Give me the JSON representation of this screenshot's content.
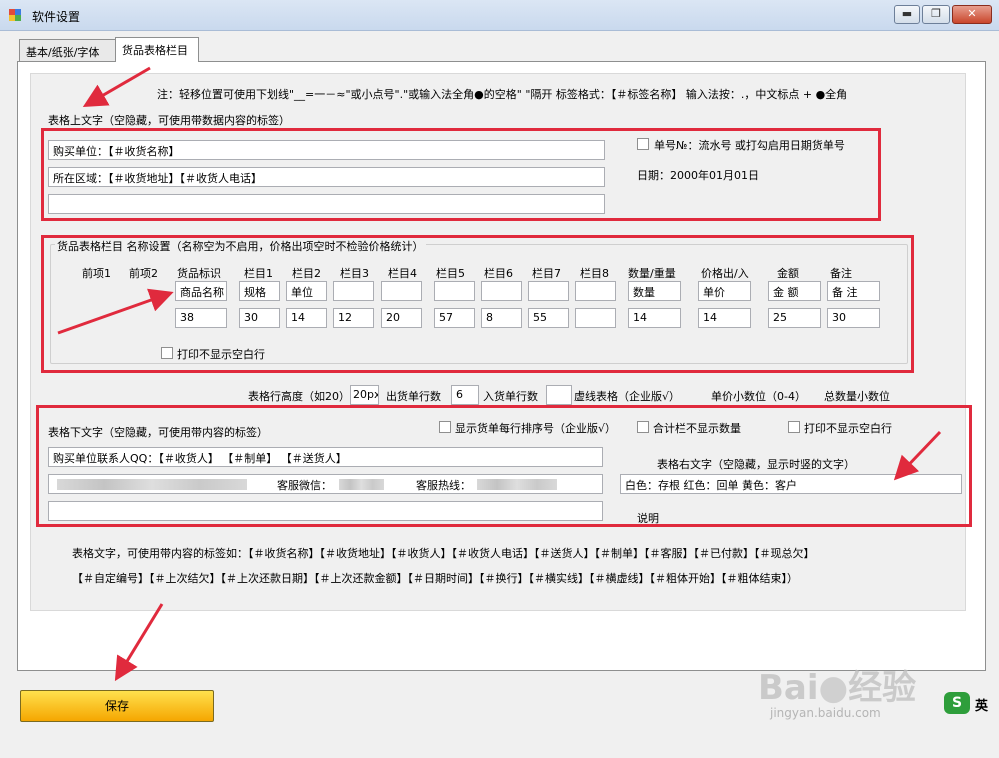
{
  "window": {
    "title": "软件设置",
    "minimize": "▬",
    "maximize": "❐",
    "close": "✕"
  },
  "tabs": [
    {
      "label": "基本/纸张/字体"
    },
    {
      "label": "货品表格栏目"
    }
  ],
  "note": "注：轻移位置可使用下划线\"__=一－≈\"或小点号\".\"或输入法全角●的空格\"  \"隔开    标签格式：【＃标签名称】  输入法按：.，中文标点 + ●全角",
  "top_section": {
    "title": "表格上文字（空隐藏，可使用带数据内容的标签）",
    "line1": "购买单位：【＃收货名称】",
    "line2": "所在区域：【＃收货地址】【＃收货人电话】",
    "line3": "",
    "order_no_label": "单号№：流水号 或打勾启用日期货单号",
    "date_label": "日期：2000年01月01日"
  },
  "columns_group": {
    "title": "货品表格栏目 名称设置（名称空为不启用，价格出项空时不检验价格统计）",
    "headers": [
      "前项1",
      "前项2",
      "货品标识",
      "栏目1",
      "栏目2",
      "栏目3",
      "栏目4",
      "栏目5",
      "栏目6",
      "栏目7",
      "栏目8",
      "数量/重量",
      "价格出/入",
      "金额",
      "备注"
    ],
    "names": [
      "商品名称",
      "规格",
      "单位",
      "",
      "",
      "",
      "",
      "",
      "",
      "数量",
      "单价",
      "金 额",
      "备 注"
    ],
    "widths": [
      "38",
      "30",
      "14",
      "12",
      "20",
      "57",
      "8",
      "55",
      "",
      "14",
      "14",
      "25",
      "30"
    ],
    "hide_blank_rows": "打印不显示空白行"
  },
  "row_settings": {
    "row_height_label": "表格行高度（如20）",
    "row_height_value": "20px",
    "out_rows_label": "出货单行数",
    "out_rows_value": "6",
    "in_rows_label": "入货单行数",
    "in_rows_value": "",
    "dashed_label": "虚线表格（企业版√）",
    "unit_decimal_label": "单价小数位（0-4）",
    "total_decimal_label": "总数量小数位"
  },
  "bottom_section": {
    "title": "表格下文字（空隐藏，可使用带内容的标签）",
    "show_row_no": "显示货单每行排序号（企业版√）",
    "hide_total_qty": "合计栏不显示数量",
    "hide_blank_rows": "打印不显示空白行",
    "line1": "购买单位联系人QQ：【＃收货人】            【＃制单】              【＃送货人】",
    "wechat_label": "客服微信：",
    "hotline_label": "客服热线：",
    "line3": "",
    "right_title": "表格右文字（空隐藏，显示时竖的文字）",
    "right_value": "白色：存根  红色：回单  黄色：客户",
    "explain": "说明"
  },
  "tags_hint_line1": "表格文字，可使用带内容的标签如：【＃收货名称】【＃收货地址】【＃收货人】【＃收货人电话】【＃送货人】【＃制单】【＃客服】【＃已付款】【＃现总欠】",
  "tags_hint_line2": "【＃自定编号】【＃上次结欠】【＃上次还款日期】【＃上次还款金额】【＃日期时间】【＃换行】【＃横实线】【＃横虚线】【＃粗体开始】【＃粗体结束】）",
  "save_button": "保存",
  "watermark": {
    "brand": "Bai",
    "brand_tail": "经验",
    "url": "jingyan.baidu.com",
    "badge": "S",
    "badge_text": "英"
  },
  "colors": {
    "accent_red": "#e02a3d",
    "save_yellow": "#f5b400"
  }
}
